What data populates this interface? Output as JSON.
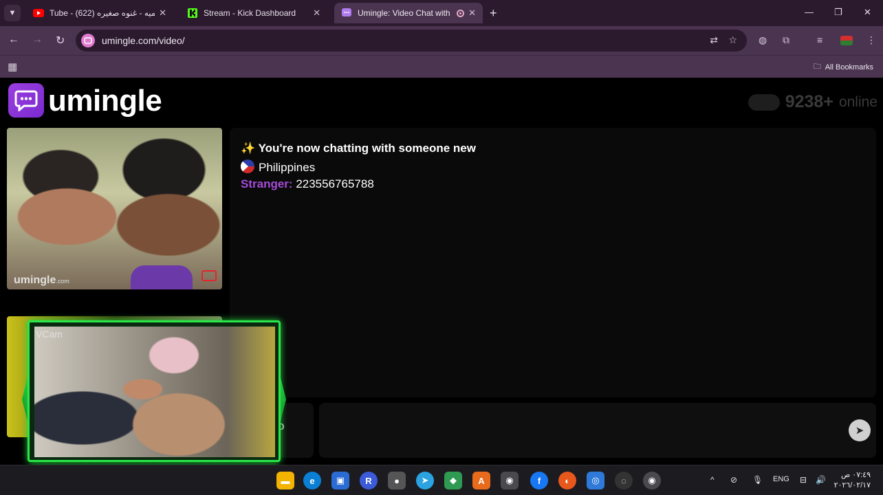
{
  "browser": {
    "tabs": [
      {
        "title": "Tube - سميه - غنوه صغيره (622)",
        "favicon": "youtube-icon"
      },
      {
        "title": "Stream - Kick Dashboard",
        "favicon": "kick-icon"
      },
      {
        "title": "Umingle: Video Chat with St",
        "favicon": "umingle-icon",
        "active": true
      }
    ],
    "url": "umingle.com/video/",
    "bookmarks_label": "All Bookmarks"
  },
  "site": {
    "logo_text": "umingle",
    "online_count": "9238+",
    "online_label": "online"
  },
  "stranger_video": {
    "watermark": "umingle",
    "watermark_suffix": ".com"
  },
  "chat": {
    "intro_emoji": "✨",
    "intro": "You're now chatting with someone new",
    "country": "Philippines",
    "messages": [
      {
        "sender": "Stranger:",
        "text": "223556765788"
      }
    ]
  },
  "controls": {
    "left_button_fragment": "o",
    "send_icon": "send-icon"
  },
  "vcam": {
    "label": "VCam"
  },
  "taskbar": {
    "language": "ENG",
    "time": "٠٧:٤٩ ص",
    "date": "٢٠٢٦/٠٢/١٧"
  },
  "colors": {
    "accent": "#8a36d9",
    "stranger_label": "#a64bd8",
    "vcam_green": "#2be64a"
  }
}
